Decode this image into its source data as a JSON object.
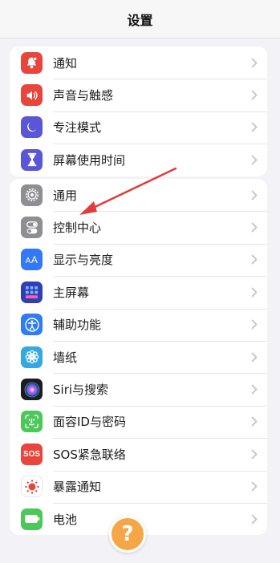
{
  "header": {
    "title": "设置"
  },
  "group1": [
    {
      "label": "通知",
      "icon": "bell-icon",
      "color": "#e8453c"
    },
    {
      "label": "声音与触感",
      "icon": "speaker-icon",
      "color": "#e8453c"
    },
    {
      "label": "专注模式",
      "icon": "moon-icon",
      "color": "#5b56d6"
    },
    {
      "label": "屏幕使用时间",
      "icon": "hourglass-icon",
      "color": "#5b56d6"
    }
  ],
  "group2": [
    {
      "label": "通用",
      "icon": "gear-icon",
      "color": "#8e8e93"
    },
    {
      "label": "控制中心",
      "icon": "toggles-icon",
      "color": "#8e8e93"
    },
    {
      "label": "显示与亮度",
      "icon": "text-size-icon",
      "color": "#3478f6"
    },
    {
      "label": "主屏幕",
      "icon": "home-grid-icon",
      "color": "#2f3fb8"
    },
    {
      "label": "辅助功能",
      "icon": "accessibility-icon",
      "color": "#2f7cf6"
    },
    {
      "label": "墙纸",
      "icon": "flower-icon",
      "color": "#35a8e0"
    },
    {
      "label": "Siri与搜索",
      "icon": "siri-icon",
      "color": "#1c1c1e"
    },
    {
      "label": "面容ID与密码",
      "icon": "face-id-icon",
      "color": "#4cc85a"
    },
    {
      "label": "SOS紧急联络",
      "icon": "sos-icon",
      "color": "#e8453c",
      "icon_text": "SOS"
    },
    {
      "label": "暴露通知",
      "icon": "exposure-icon",
      "color": "#ffffff"
    },
    {
      "label": "电池",
      "icon": "battery-icon",
      "color": "#4cc85a"
    }
  ],
  "help_button": {
    "label": "?",
    "color": "#f5a646"
  },
  "annotation": {
    "arrow_color": "#e33b3b"
  }
}
